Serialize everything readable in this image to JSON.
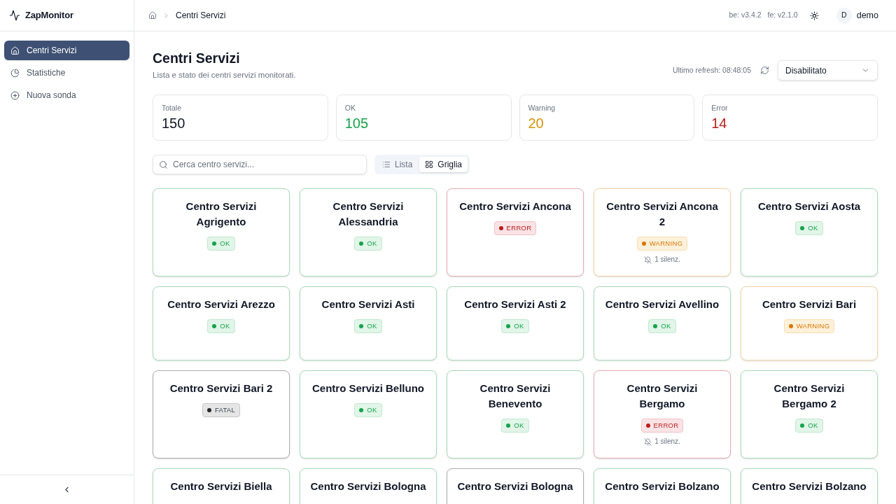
{
  "sidebar": {
    "logo": "ZapMonitor",
    "items": [
      {
        "label": "Centri Servizi",
        "selected": true
      },
      {
        "label": "Statistiche",
        "selected": false
      },
      {
        "label": "Nuova sonda",
        "selected": false
      }
    ]
  },
  "header": {
    "breadcrumb": [
      "Centri Servizi"
    ],
    "versions": [
      "be: v3.4.2",
      "fe: v2.1.0"
    ],
    "user": {
      "avatar": "D",
      "name": "demo"
    }
  },
  "page": {
    "title": "Centri Servizi",
    "subtitle": "Lista e stato dei centri servizi monitorati.",
    "last_refresh": "Ultimo refresh: 08:48:05",
    "auto_refresh": {
      "value": "Disabilitato"
    }
  },
  "stats": [
    {
      "label": "Totale",
      "value": "150",
      "color": "#111827"
    },
    {
      "label": "OK",
      "value": "105",
      "color": "#16a34a"
    },
    {
      "label": "Warning",
      "value": "20",
      "color": "#d4950b"
    },
    {
      "label": "Error",
      "value": "14",
      "color": "#b91c1c"
    }
  ],
  "search": {
    "placeholder": "Cerca centro servizi..."
  },
  "view_toggle": [
    {
      "label": "Lista",
      "selected": false
    },
    {
      "label": "Griglia",
      "selected": true
    }
  ],
  "cards": [
    {
      "title": "Centro Servizi Agrigento",
      "kind": "ok",
      "badge": "OK"
    },
    {
      "title": "Centro Servizi Alessandria",
      "kind": "ok",
      "badge": "OK"
    },
    {
      "title": "Centro Servizi Ancona",
      "kind": "error",
      "badge": "ERROR"
    },
    {
      "title": "Centro Servizi Ancona 2",
      "kind": "warning",
      "badge": "WARNING",
      "silenced": "1 silenz."
    },
    {
      "title": "Centro Servizi Aosta",
      "kind": "ok",
      "badge": "OK"
    },
    {
      "title": "Centro Servizi Arezzo",
      "kind": "ok",
      "badge": "OK"
    },
    {
      "title": "Centro Servizi Asti",
      "kind": "ok",
      "badge": "OK"
    },
    {
      "title": "Centro Servizi Asti 2",
      "kind": "ok",
      "badge": "OK"
    },
    {
      "title": "Centro Servizi Avellino",
      "kind": "ok",
      "badge": "OK"
    },
    {
      "title": "Centro Servizi Bari",
      "kind": "warning",
      "badge": "WARNING"
    },
    {
      "title": "Centro Servizi Bari 2",
      "kind": "fatal",
      "badge": "FATAL"
    },
    {
      "title": "Centro Servizi Belluno",
      "kind": "ok",
      "badge": "OK"
    },
    {
      "title": "Centro Servizi Benevento",
      "kind": "ok",
      "badge": "OK"
    },
    {
      "title": "Centro Servizi Bergamo",
      "kind": "error",
      "badge": "ERROR",
      "silenced": "1 silenz."
    },
    {
      "title": "Centro Servizi Bergamo 2",
      "kind": "ok",
      "badge": "OK"
    },
    {
      "title": "Centro Servizi Biella",
      "kind": "ok"
    },
    {
      "title": "Centro Servizi Bologna",
      "kind": "ok"
    },
    {
      "title": "Centro Servizi Bologna",
      "kind": "fatal"
    },
    {
      "title": "Centro Servizi Bolzano",
      "kind": "ok"
    },
    {
      "title": "Centro Servizi Bolzano",
      "kind": "ok"
    }
  ]
}
